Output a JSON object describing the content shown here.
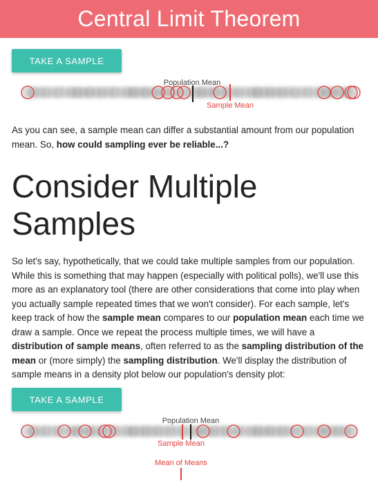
{
  "header": {
    "title": "Central Limit Theorem"
  },
  "buttons": {
    "sample_1": "TAKE A SAMPLE",
    "sample_2": "TAKE A SAMPLE"
  },
  "strip_1": {
    "population_mean_label": "Population Mean",
    "sample_mean_label": "Sample Mean"
  },
  "paragraph_1": {
    "plain": "As you can see, a sample mean can differ a substantial amount from our population mean. So, ",
    "bold": "how could sampling ever be reliable...?"
  },
  "section": {
    "title": "Consider Multiple Samples"
  },
  "paragraph_2": {
    "t1": "So let's say, hypothetically, that we could take multiple samples from our population. While this is something that may happen (especially with political polls), we'll use this more as an explanatory tool (there are other considerations that come into play when you actually sample repeated times that we won't consider). For each sample, let's keep track of how the ",
    "b1": "sample mean",
    "t2": " compares to our ",
    "b2": "population mean",
    "t3": " each time we draw a sample. Once we repeat the process multiple times, we will have a ",
    "b3": "distribution of sample means",
    "t4": ", often referred to as the ",
    "b4": "sampling distribution of the mean",
    "t5": " or (more simply) the ",
    "b5": "sampling distribution",
    "t6": ". We'll display the distribution of sample means in a density plot below our population's density plot:"
  },
  "strip_2": {
    "population_mean_label": "Population Mean",
    "sample_mean_label": "Sample Mean",
    "mean_of_means_label": "Mean of Means"
  },
  "colors": {
    "header": "#ef6b73",
    "button": "#3dbfad",
    "sample_circle": "#e03c3c",
    "population_dot": "#8a8a8a",
    "mean_line": "#111111",
    "sample_mean_line": "#e03c3c"
  }
}
